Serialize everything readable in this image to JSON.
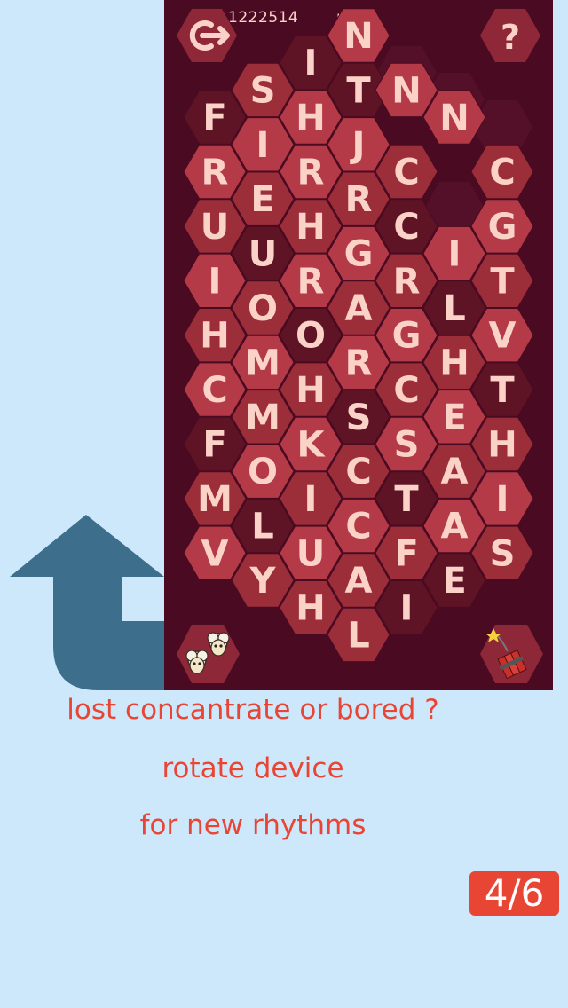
{
  "hud": {
    "score": "1222514",
    "status": "none"
  },
  "icons": {
    "exit": "exit-arrow-icon",
    "help": "question-mark-icon",
    "sheep": "sheep-icon",
    "dynamite": "dynamite-bomb-icon",
    "rotate_arrow": "rotate-arrow-icon"
  },
  "colors": {
    "background": "#cde8fb",
    "board": "#4a0a22",
    "tile_light": "#b33a46",
    "tile_dark": "#9c2e3a",
    "tile_darkest": "#5e1424",
    "letter": "#fbd2c8",
    "accent": "#e84535",
    "arrow": "#3d6f8c"
  },
  "tiles": [
    {
      "row": 0,
      "letter": "N"
    },
    {
      "row": 1,
      "letter": "I"
    },
    {
      "row": 2,
      "letter": "S"
    },
    {
      "row": 2,
      "letter": "T"
    },
    {
      "row": 2,
      "letter": "N"
    },
    {
      "row": 3,
      "letter": "F"
    },
    {
      "row": 3,
      "letter": "H"
    },
    {
      "row": 3,
      "letter": "N"
    },
    {
      "row": 4,
      "letter": "I"
    },
    {
      "row": 4,
      "letter": "J"
    },
    {
      "row": 5,
      "letter": "R"
    },
    {
      "row": 5,
      "letter": "R"
    },
    {
      "row": 5,
      "letter": "C"
    },
    {
      "row": 5,
      "letter": "C"
    },
    {
      "row": 6,
      "letter": "E"
    },
    {
      "row": 6,
      "letter": "R"
    },
    {
      "row": 7,
      "letter": "U"
    },
    {
      "row": 7,
      "letter": "H"
    },
    {
      "row": 7,
      "letter": "C"
    },
    {
      "row": 7,
      "letter": "G"
    },
    {
      "row": 8,
      "letter": "U"
    },
    {
      "row": 8,
      "letter": "G"
    },
    {
      "row": 8,
      "letter": "I"
    },
    {
      "row": 9,
      "letter": "I"
    },
    {
      "row": 9,
      "letter": "R"
    },
    {
      "row": 9,
      "letter": "R"
    },
    {
      "row": 9,
      "letter": "T"
    },
    {
      "row": 10,
      "letter": "O"
    },
    {
      "row": 10,
      "letter": "A"
    },
    {
      "row": 10,
      "letter": "L"
    },
    {
      "row": 11,
      "letter": "H"
    },
    {
      "row": 11,
      "letter": "O"
    },
    {
      "row": 11,
      "letter": "G"
    },
    {
      "row": 11,
      "letter": "V"
    },
    {
      "row": 12,
      "letter": "M"
    },
    {
      "row": 12,
      "letter": "R"
    },
    {
      "row": 12,
      "letter": "H"
    },
    {
      "row": 13,
      "letter": "C"
    },
    {
      "row": 13,
      "letter": "H"
    },
    {
      "row": 13,
      "letter": "C"
    },
    {
      "row": 13,
      "letter": "T"
    },
    {
      "row": 14,
      "letter": "M"
    },
    {
      "row": 14,
      "letter": "S"
    },
    {
      "row": 14,
      "letter": "E"
    },
    {
      "row": 15,
      "letter": "F"
    },
    {
      "row": 15,
      "letter": "K"
    },
    {
      "row": 15,
      "letter": "S"
    },
    {
      "row": 15,
      "letter": "H"
    },
    {
      "row": 16,
      "letter": "O"
    },
    {
      "row": 16,
      "letter": "C"
    },
    {
      "row": 16,
      "letter": "A"
    },
    {
      "row": 17,
      "letter": "M"
    },
    {
      "row": 17,
      "letter": "I"
    },
    {
      "row": 17,
      "letter": "T"
    },
    {
      "row": 17,
      "letter": "I"
    },
    {
      "row": 18,
      "letter": "L"
    },
    {
      "row": 18,
      "letter": "C"
    },
    {
      "row": 18,
      "letter": "A"
    },
    {
      "row": 19,
      "letter": "V"
    },
    {
      "row": 19,
      "letter": "U"
    },
    {
      "row": 19,
      "letter": "F"
    },
    {
      "row": 19,
      "letter": "S"
    },
    {
      "row": 20,
      "letter": "Y"
    },
    {
      "row": 20,
      "letter": "A"
    },
    {
      "row": 20,
      "letter": "E"
    },
    {
      "row": 21,
      "letter": "H"
    },
    {
      "row": 21,
      "letter": "I"
    },
    {
      "row": 22,
      "letter": "L"
    }
  ],
  "captions": {
    "line1": "lost concantrate or bored ?",
    "line2": "rotate device",
    "line3": "for new rhythms"
  },
  "page_indicator": "4/6"
}
